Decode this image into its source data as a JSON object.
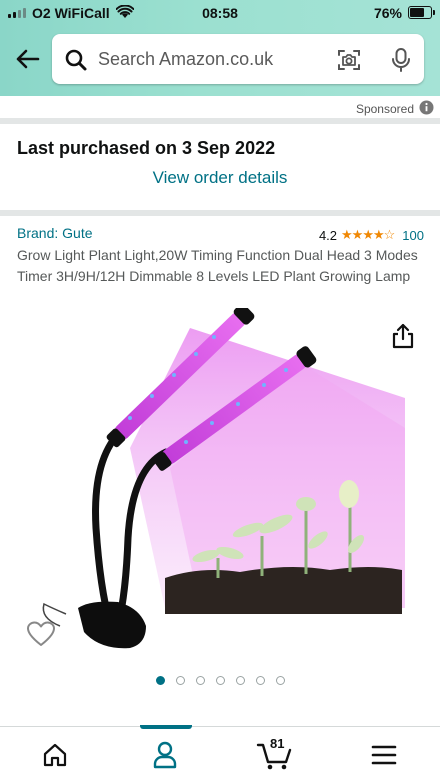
{
  "status_bar": {
    "carrier": "O2 WiFiCall",
    "time": "08:58",
    "battery": "76%"
  },
  "search": {
    "placeholder": "Search Amazon.co.uk"
  },
  "sponsored_label": "Sponsored",
  "purchase": {
    "title": "Last purchased on 3 Sep 2022",
    "link": "View order details"
  },
  "product": {
    "brand": "Brand: Gute",
    "rating": "4.2",
    "rating_value": 4.2,
    "review_count": "100",
    "title": "Grow Light Plant Light,20W Timing Function Dual Head 3 Modes Timer 3H/9H/12H Dimmable 8 Levels LED Plant Growing Lamp",
    "image_count": 7,
    "active_image_index": 0
  },
  "bottom_nav": {
    "cart_count": "81",
    "active_tab": "account"
  },
  "colors": {
    "link": "#007185",
    "star": "#f08804",
    "header_gradient_start": "#8ad6c8",
    "header_gradient_end": "#a5e3d6"
  },
  "icons": [
    "back-arrow-icon",
    "search-icon",
    "camera-icon",
    "microphone-icon",
    "info-icon",
    "share-icon",
    "heart-icon",
    "home-icon",
    "account-icon",
    "cart-icon",
    "menu-icon",
    "wifi-icon",
    "battery-icon",
    "signal-icon"
  ]
}
